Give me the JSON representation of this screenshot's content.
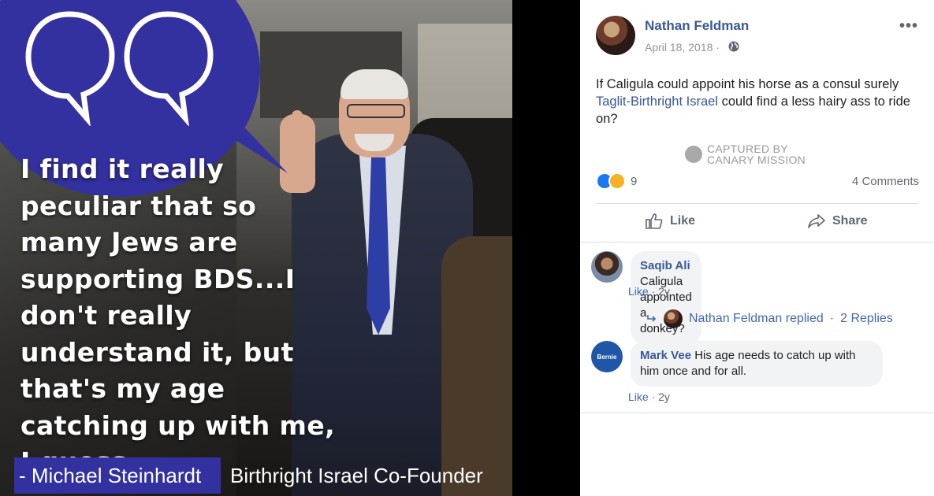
{
  "image": {
    "quote": "I find it really peculiar that so many Jews are supporting BDS...I don't really understand it, but that's my age catching up with me, I guess.",
    "attribution_name": "- Michael Steinhardt",
    "attribution_role": "Birthright Israel Co-Founder",
    "colors": {
      "accent": "#3330a0"
    }
  },
  "post": {
    "author": "Nathan Feldman",
    "date": "April 18, 2018 ·",
    "more": "•••",
    "text_prefix": "If Caligula could appoint his horse as a consul surely ",
    "text_link": "Taglit-Birthright Israel",
    "text_suffix": " could find a less hairy ass to ride on?",
    "watermark": "CAPTURED BY CANARY MISSION",
    "reaction_count": "9",
    "comments_count": "4 Comments",
    "actions": {
      "like": "Like",
      "share": "Share"
    }
  },
  "comments": [
    {
      "name": "Saqib Ali",
      "text": "Caligula appointed a donkey?",
      "like": "Like",
      "time": "· 2y"
    },
    {
      "name": "Mark Vee",
      "text": "His age needs to catch up with him once and for all.",
      "like": "Like",
      "time": "· 2y",
      "avatar_text": "Bernie"
    }
  ],
  "reply_summary": {
    "author_replied": "Nathan Feldman replied",
    "dot": "·",
    "replies": "2 Replies"
  },
  "colors": {
    "link": "#385898",
    "meta": "#606770",
    "divider": "#dadde1"
  }
}
